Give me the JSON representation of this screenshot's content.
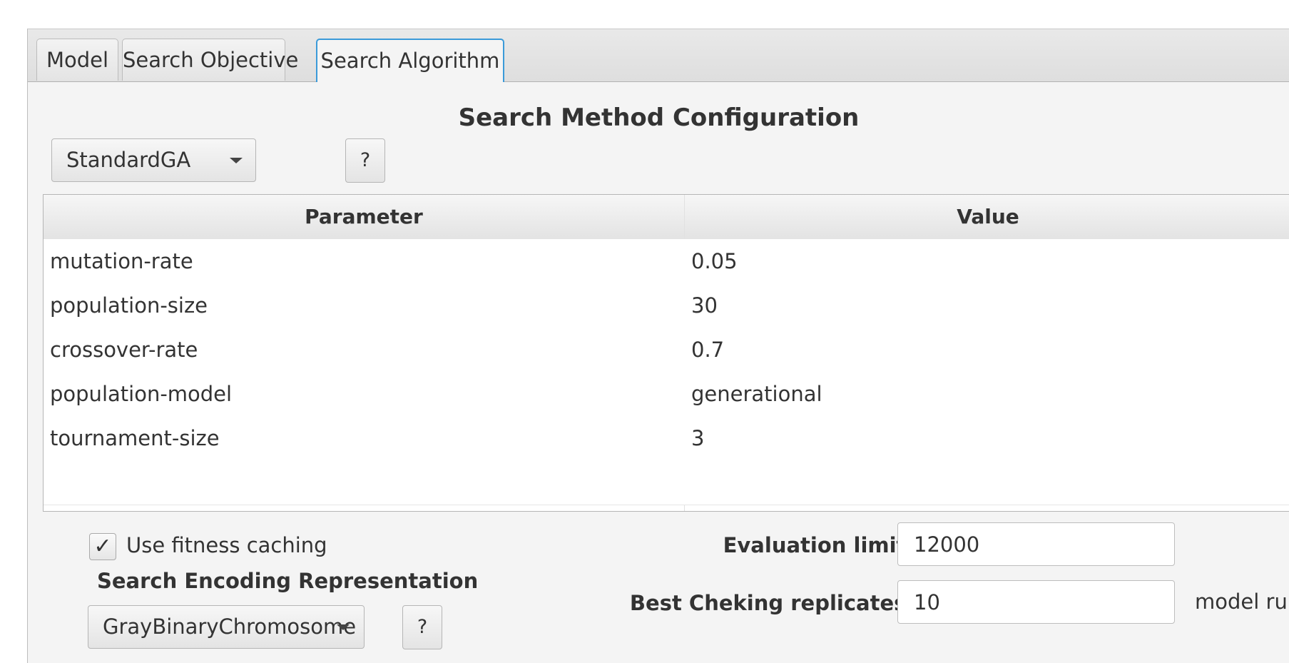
{
  "tabs": [
    {
      "label": "Model"
    },
    {
      "label": "Search Objective"
    },
    {
      "label": "Search Algorithm"
    }
  ],
  "section_title": "Search Method Configuration",
  "method_select": {
    "value": "StandardGA"
  },
  "help_label": "?",
  "table": {
    "headers": [
      "Parameter",
      "Value"
    ],
    "rows": [
      {
        "param": "mutation-rate",
        "value": "0.05"
      },
      {
        "param": "population-size",
        "value": "30"
      },
      {
        "param": "crossover-rate",
        "value": "0.7"
      },
      {
        "param": "population-model",
        "value": "generational"
      },
      {
        "param": "tournament-size",
        "value": "3"
      }
    ]
  },
  "fitness_caching": {
    "label": "Use fitness caching",
    "checked": true,
    "mark": "✓"
  },
  "encoding": {
    "title": "Search Encoding Representation",
    "value": "GrayBinaryChromosome"
  },
  "evaluation_limit": {
    "label": "Evaluation limit:",
    "value": "12000"
  },
  "best_checking": {
    "label": "Best Cheking replicates:",
    "value": "10",
    "suffix": "model run"
  }
}
